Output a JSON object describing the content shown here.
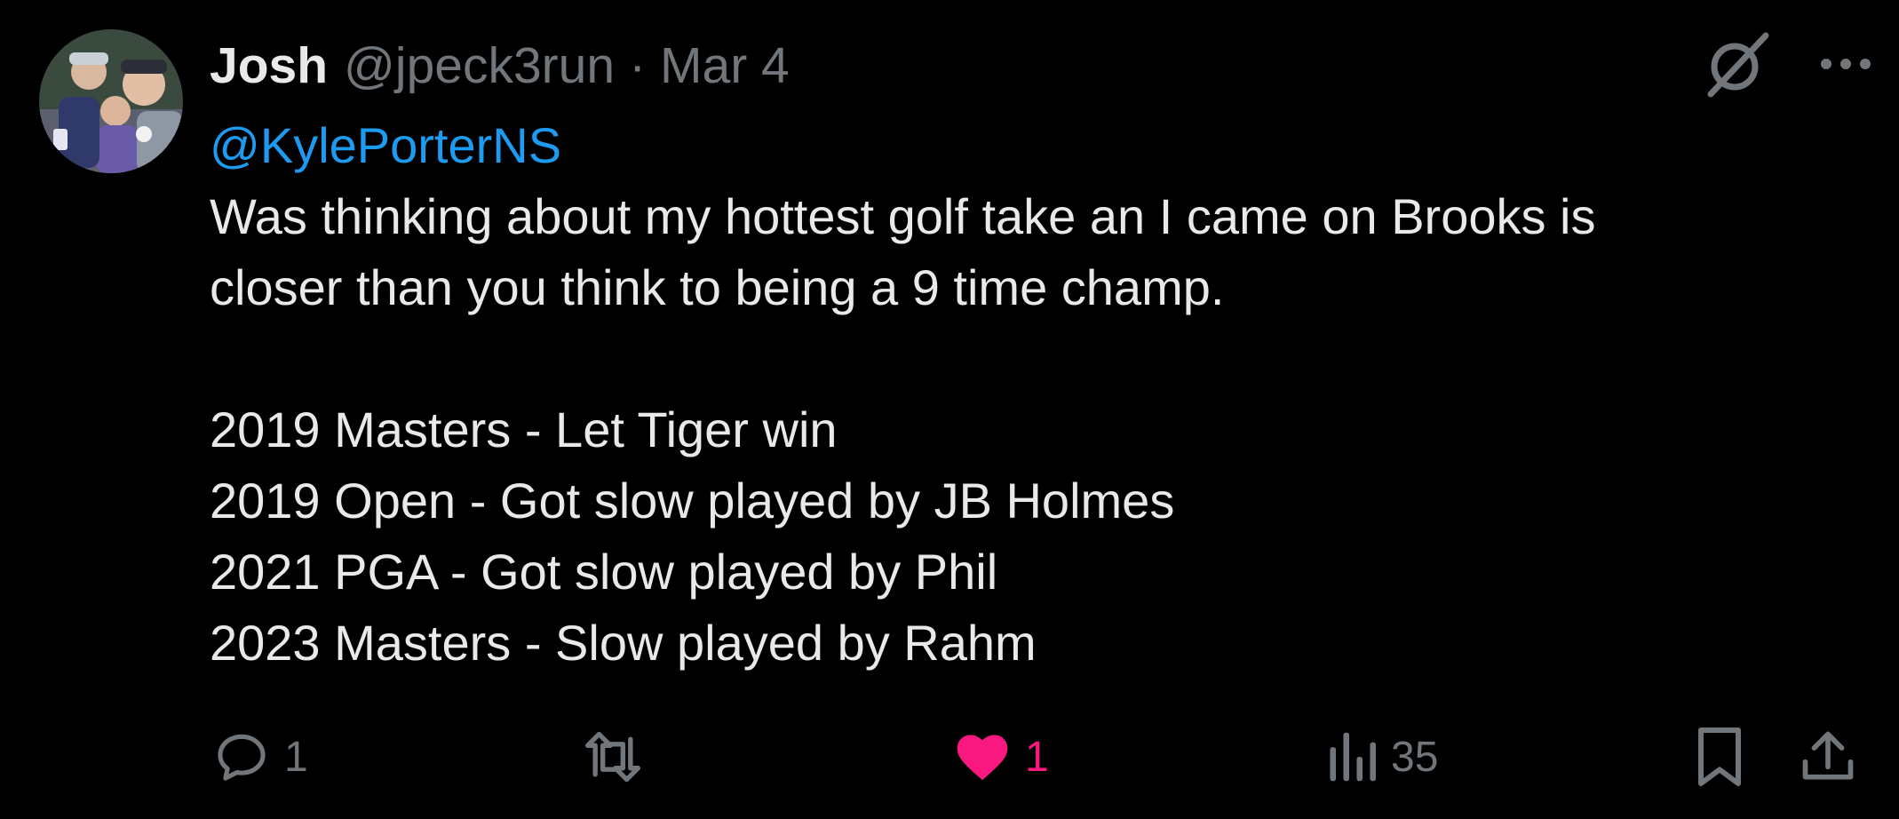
{
  "tweet": {
    "author": {
      "display_name": "Josh",
      "handle": "@jpeck3run",
      "separator": "·",
      "date": "Mar 4"
    },
    "mention": "@KylePorterNS",
    "text": "Was thinking about my hottest golf take an I came on Brooks is\ncloser than you think to being a 9 time champ.\n\n2019 Masters - Let Tiger win\n2019 Open - Got slow played by JB Holmes\n2021 PGA - Got slow played by Phil\n2023 Masters - Slow played by Rahm",
    "stats": {
      "replies": "1",
      "retweets": "",
      "likes": "1",
      "views": "35"
    },
    "liked": true
  },
  "icons": {
    "grok": "grok-icon",
    "more": "more-icon",
    "reply": "reply-icon",
    "retweet": "retweet-icon",
    "like": "heart-icon",
    "views": "analytics-icon",
    "bookmark": "bookmark-icon",
    "share": "share-icon"
  },
  "colors": {
    "background": "#000000",
    "text": "#e7e9ea",
    "secondary": "#71767b",
    "link": "#1d9bf0",
    "like": "#f91880"
  }
}
